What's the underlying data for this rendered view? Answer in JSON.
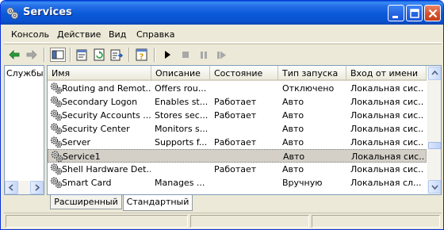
{
  "window": {
    "title": "Services"
  },
  "menu": [
    {
      "id": "console",
      "label": "Консоль"
    },
    {
      "id": "action",
      "label": "Действие"
    },
    {
      "id": "view",
      "label": "Вид"
    },
    {
      "id": "help",
      "label": "Справка"
    }
  ],
  "toolbar": {
    "icons": [
      "back-arrow-icon",
      "forward-arrow-icon",
      "show-hide-tree-icon",
      "properties-icon",
      "refresh-icon",
      "export-list-icon",
      "help-icon",
      "start-service-icon",
      "stop-service-icon",
      "pause-service-icon",
      "restart-service-icon"
    ]
  },
  "tree": {
    "root_label": "Службы"
  },
  "list": {
    "columns": [
      "Имя",
      "Описание",
      "Состояние",
      "Тип запуска",
      "Вход от имени"
    ],
    "rows": [
      {
        "name": "Routing and Remot...",
        "description": "Offers rou...",
        "status": "",
        "startup": "Отключено",
        "logon": "Локальная сис..."
      },
      {
        "name": "Secondary Logon",
        "description": "Enables st...",
        "status": "Работает",
        "startup": "Авто",
        "logon": "Локальная сис..."
      },
      {
        "name": "Security Accounts ...",
        "description": "Stores sec...",
        "status": "Работает",
        "startup": "Авто",
        "logon": "Локальная сис..."
      },
      {
        "name": "Security Center",
        "description": "Monitors s...",
        "status": "",
        "startup": "Авто",
        "logon": "Локальная сис..."
      },
      {
        "name": "Server",
        "description": "Supports f...",
        "status": "Работает",
        "startup": "Авто",
        "logon": "Локальная сис..."
      },
      {
        "name": "Service1",
        "description": "",
        "status": "",
        "startup": "Авто",
        "logon": "Локальная сис...",
        "selected": true
      },
      {
        "name": "Shell Hardware Det...",
        "description": "",
        "status": "Работает",
        "startup": "Авто",
        "logon": "Локальная сис..."
      },
      {
        "name": "Smart Card",
        "description": "Manages ...",
        "status": "",
        "startup": "Вручную",
        "logon": "Локальная сл..."
      }
    ]
  },
  "tabs": [
    {
      "label": "Расширенный",
      "active": false
    },
    {
      "label": "Стандартный",
      "active": true
    }
  ],
  "colors": {
    "titlebar": "#0a52cf",
    "frame": "#ece9d8",
    "selection": "#d4d0c8"
  }
}
